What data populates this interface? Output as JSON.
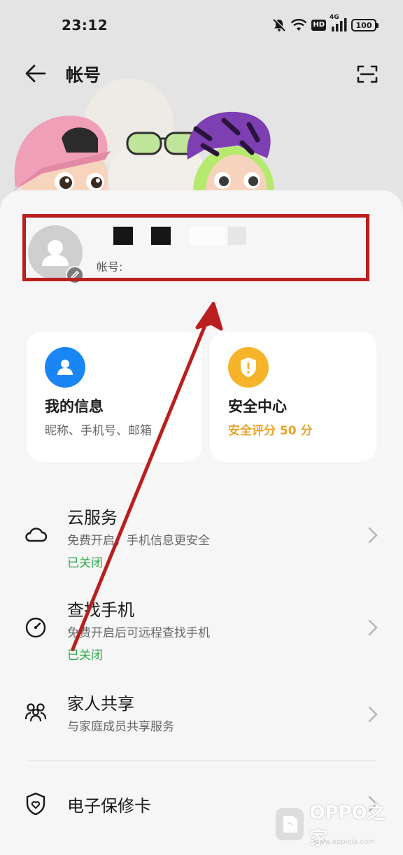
{
  "status_bar": {
    "time": "23:12",
    "network_label": "HD",
    "signal_label": "4G",
    "battery": "100"
  },
  "header": {
    "title": "帐号",
    "back_icon": "arrow-left-icon",
    "scan_icon": "scan-icon"
  },
  "profile": {
    "account_label": "帐号:",
    "highlight_color": "#b91f1f"
  },
  "cards": [
    {
      "title": "我的信息",
      "subtitle": "昵称、手机号、邮箱",
      "icon": "person-icon",
      "color": "#1a86f5"
    },
    {
      "title": "安全中心",
      "subtitle": "安全评分 50 分",
      "icon": "shield-icon",
      "color": "#f5b42a"
    }
  ],
  "list": [
    {
      "title": "云服务",
      "subtitle": "免费开启，手机信息更安全",
      "status": "已关闭",
      "icon": "cloud-icon"
    },
    {
      "title": "查找手机",
      "subtitle": "免费开启后可远程查找手机",
      "status": "已关闭",
      "icon": "locate-icon"
    },
    {
      "title": "家人共享",
      "subtitle": "与家庭成员共享服务",
      "icon": "family-icon"
    },
    {
      "title": "电子保修卡",
      "icon": "shield-heart-icon"
    }
  ],
  "colors": {
    "status_green": "#2eaa4c",
    "accent_orange": "#e8a32b",
    "arrow_red": "#b91f1f"
  },
  "watermark": {
    "text": "OPPO之家",
    "url": "www.oppojia.com"
  }
}
